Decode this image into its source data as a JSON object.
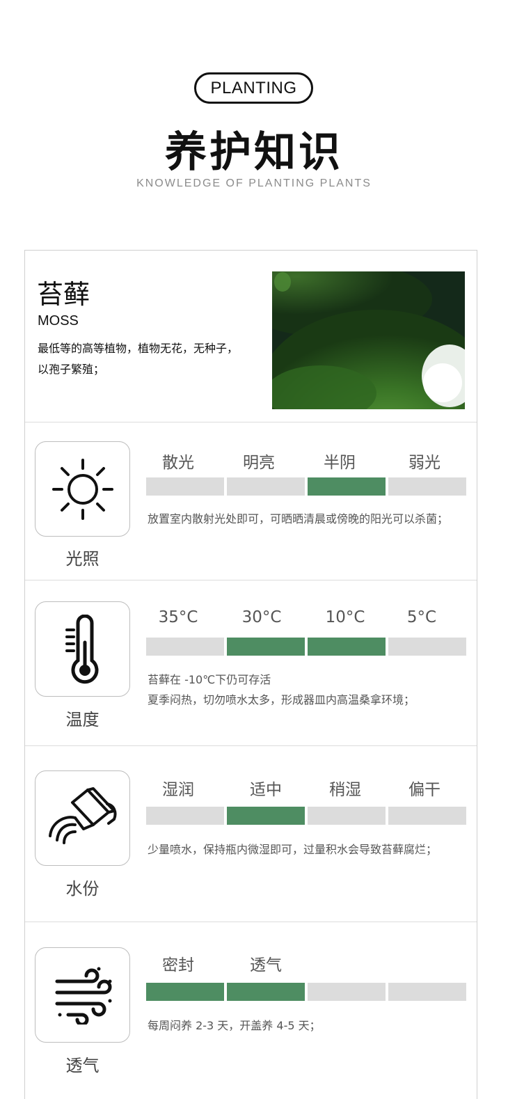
{
  "header": {
    "badge": "PLANTING",
    "title": "养护知识",
    "subtitle": "KNOWLEDGE  OF  PLANTING PLANTS"
  },
  "plant": {
    "name": "苔藓",
    "name_en": "MOSS",
    "desc_line1": "最低等的高等植物，植物无花，无种子，",
    "desc_line2": "以孢子繁殖；"
  },
  "sections": [
    {
      "label": "光照",
      "icon": "sun-icon",
      "levels": [
        "散光",
        "明亮",
        "半阴",
        "弱光"
      ],
      "active": [
        false,
        false,
        true,
        false
      ],
      "notes": [
        "放置室内散射光处即可，可晒晒清晨或傍晚的阳光可以杀菌；"
      ]
    },
    {
      "label": "温度",
      "icon": "thermometer-icon",
      "levels": [
        "35°C",
        "30°C",
        "10°C",
        "5°C"
      ],
      "active": [
        false,
        true,
        true,
        false
      ],
      "notes": [
        "苔藓在 -10℃下仍可存活",
        "夏季闷热，切勿喷水太多，形成器皿内高温桑拿环境；"
      ]
    },
    {
      "label": "水份",
      "icon": "watering-can-icon",
      "levels": [
        "湿润",
        "适中",
        "稍湿",
        "偏干"
      ],
      "active": [
        false,
        true,
        false,
        false
      ],
      "notes": [
        "少量喷水，保持瓶内微湿即可，过量积水会导致苔藓腐烂；"
      ]
    },
    {
      "label": "透气",
      "icon": "wind-icon",
      "levels": [
        "密封",
        "透气"
      ],
      "active": [
        true,
        true,
        false,
        false
      ],
      "notes": [
        "每周闷养 2-3 天，开盖养 4-5 天；"
      ]
    }
  ],
  "colors": {
    "active_bar": "#4e8d62",
    "inactive_bar": "#dcdcdc"
  }
}
